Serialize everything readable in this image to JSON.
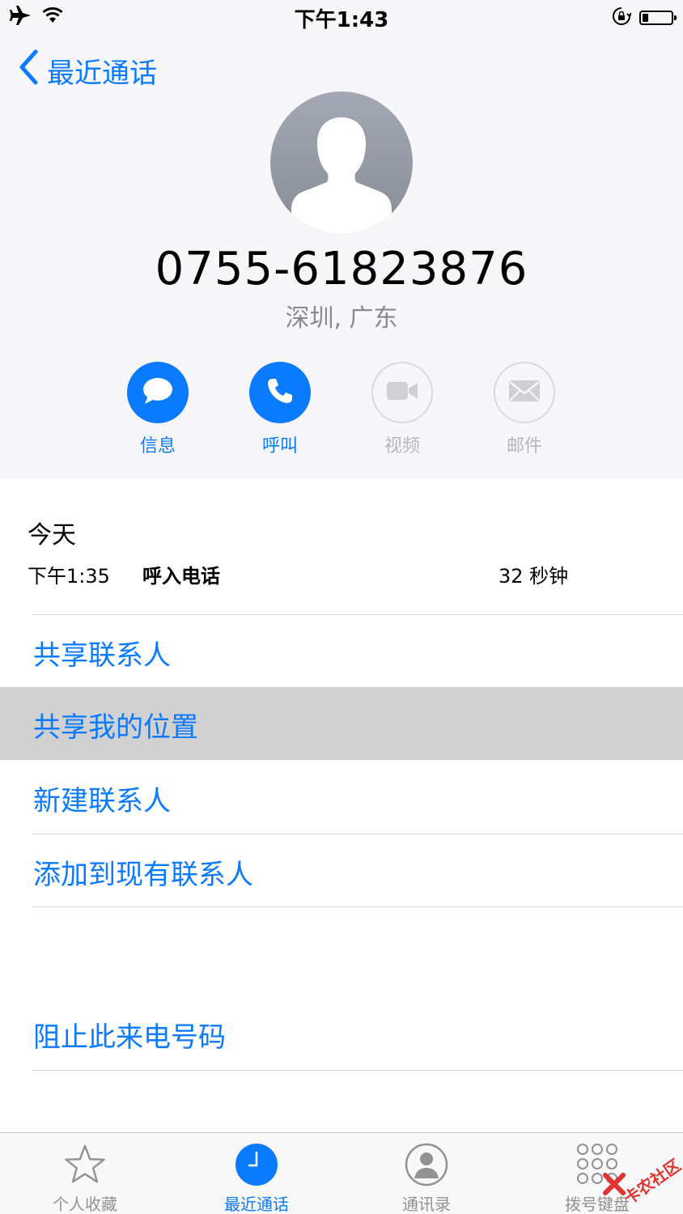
{
  "status_bar": {
    "time": "下午1:43",
    "battery_level": 0.22
  },
  "nav": {
    "back_label": "最近通话"
  },
  "contact": {
    "number": "0755-61823876",
    "location": "深圳, 广东"
  },
  "actions": [
    {
      "label": "信息",
      "icon": "message-icon",
      "enabled": true
    },
    {
      "label": "呼叫",
      "icon": "phone-icon",
      "enabled": true
    },
    {
      "label": "视频",
      "icon": "video-icon",
      "enabled": false
    },
    {
      "label": "邮件",
      "icon": "mail-icon",
      "enabled": false
    }
  ],
  "history": {
    "day": "今天",
    "entries": [
      {
        "time": "下午1:35",
        "type": "呼入电话",
        "duration": "32 秒钟"
      }
    ]
  },
  "menu": {
    "share_contact": "共享联系人",
    "share_location": "共享我的位置",
    "new_contact": "新建联系人",
    "add_existing": "添加到现有联系人",
    "block": "阻止此来电号码"
  },
  "tab_bar": {
    "tabs": [
      {
        "label": "个人收藏",
        "icon": "star-icon",
        "selected": false
      },
      {
        "label": "最近通话",
        "icon": "clock-icon",
        "selected": true
      },
      {
        "label": "通讯录",
        "icon": "contacts-icon",
        "selected": false
      },
      {
        "label": "拨号键盘",
        "icon": "keypad-icon",
        "selected": false
      }
    ]
  },
  "watermark": {
    "text": "卡农社区"
  },
  "colors": {
    "accent": "#0a7aff",
    "disabled": "#b6b6bb",
    "highlight_row": "#d1d1d1"
  }
}
